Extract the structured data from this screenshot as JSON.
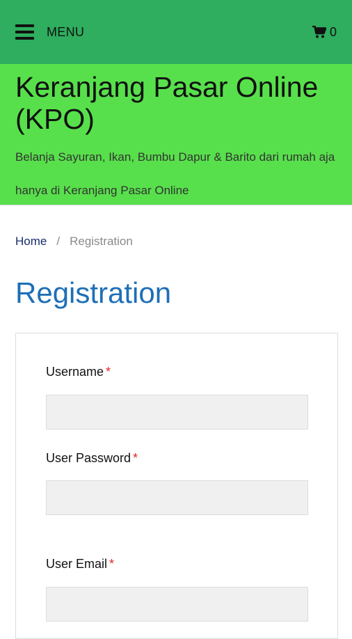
{
  "header": {
    "menu_label": "MENU",
    "cart_count": "0"
  },
  "brand": {
    "title": "Keranjang Pasar Online (KPO)",
    "tagline": "Belanja Sayuran, Ikan, Bumbu Dapur & Barito dari rumah aja hanya di Keranjang Pasar Online"
  },
  "breadcrumb": {
    "home": "Home",
    "separator": "/",
    "current": "Registration"
  },
  "page": {
    "title": "Registration"
  },
  "form": {
    "required_marker": "*",
    "fields": [
      {
        "label": "Username",
        "value": "",
        "placeholder": ""
      },
      {
        "label": "User Password",
        "value": "",
        "placeholder": ""
      },
      {
        "label": "User Email",
        "value": "",
        "placeholder": ""
      }
    ]
  },
  "colors": {
    "topbar": "#2eae5e",
    "brand_bg": "#57e04b",
    "title_blue": "#1e6fb7",
    "required_red": "#e02424"
  }
}
